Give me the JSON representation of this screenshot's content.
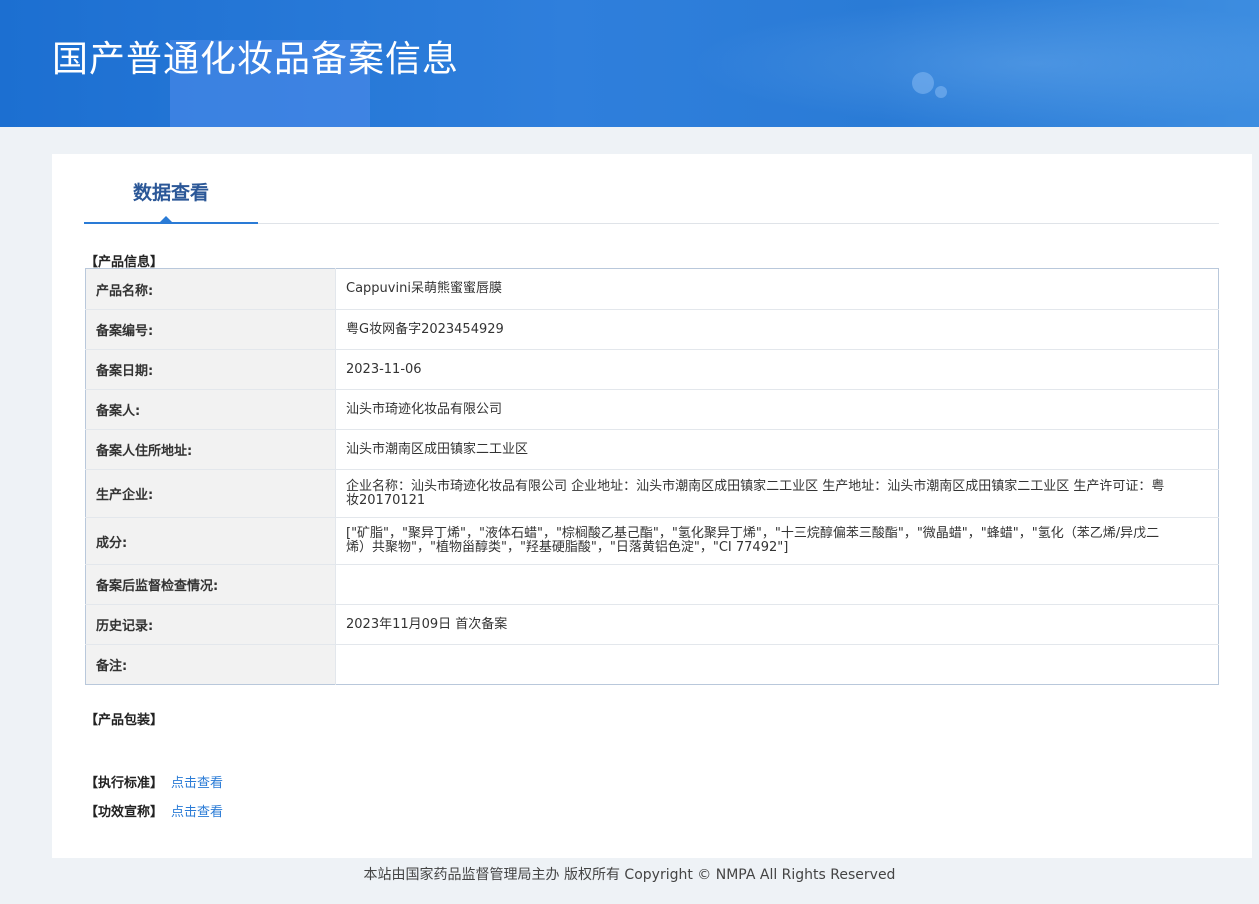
{
  "header": {
    "title": "国产普通化妆品备案信息"
  },
  "tabs": [
    {
      "label": "数据查看",
      "active": true
    }
  ],
  "product_info": {
    "section_title": "【产品信息】",
    "rows": [
      {
        "label": "产品名称:",
        "value": "Cappuvini呆萌熊蜜蜜唇膜"
      },
      {
        "label": "备案编号:",
        "value": "粤G妆网备字2023454929"
      },
      {
        "label": "备案日期:",
        "value": "2023-11-06"
      },
      {
        "label": "备案人:",
        "value": "汕头市琦迹化妆品有限公司"
      },
      {
        "label": "备案人住所地址:",
        "value": "汕头市潮南区成田镇家二工业区"
      },
      {
        "label": "生产企业:",
        "value": "企业名称：汕头市琦迹化妆品有限公司 企业地址：汕头市潮南区成田镇家二工业区 生产地址：汕头市潮南区成田镇家二工业区 生产许可证：粤妆20170121"
      },
      {
        "label": "成分:",
        "value": "[\"矿脂\"，\"聚异丁烯\"，\"液体石蜡\"，\"棕榈酸乙基己酯\"，\"氢化聚异丁烯\"，\"十三烷醇偏苯三酸酯\"，\"微晶蜡\"，\"蜂蜡\"，\"氢化（苯乙烯/异戊二烯）共聚物\"，\"植物甾醇类\"，\"羟基硬脂酸\"，\"日落黄铝色淀\"，\"CI 77492\"]"
      },
      {
        "label": "备案后监督检查情况:",
        "value": ""
      },
      {
        "label": "历史记录:",
        "value": "2023年11月09日 首次备案"
      },
      {
        "label": "备注:",
        "value": ""
      }
    ]
  },
  "packaging": {
    "section_title": "【产品包装】"
  },
  "standard": {
    "label": "【执行标准】",
    "link": "点击查看"
  },
  "efficacy": {
    "label": "【功效宣称】",
    "link": "点击查看"
  },
  "footer": {
    "text": "本站由国家药品监督管理局主办 版权所有 Copyright © NMPA All Rights Reserved"
  }
}
